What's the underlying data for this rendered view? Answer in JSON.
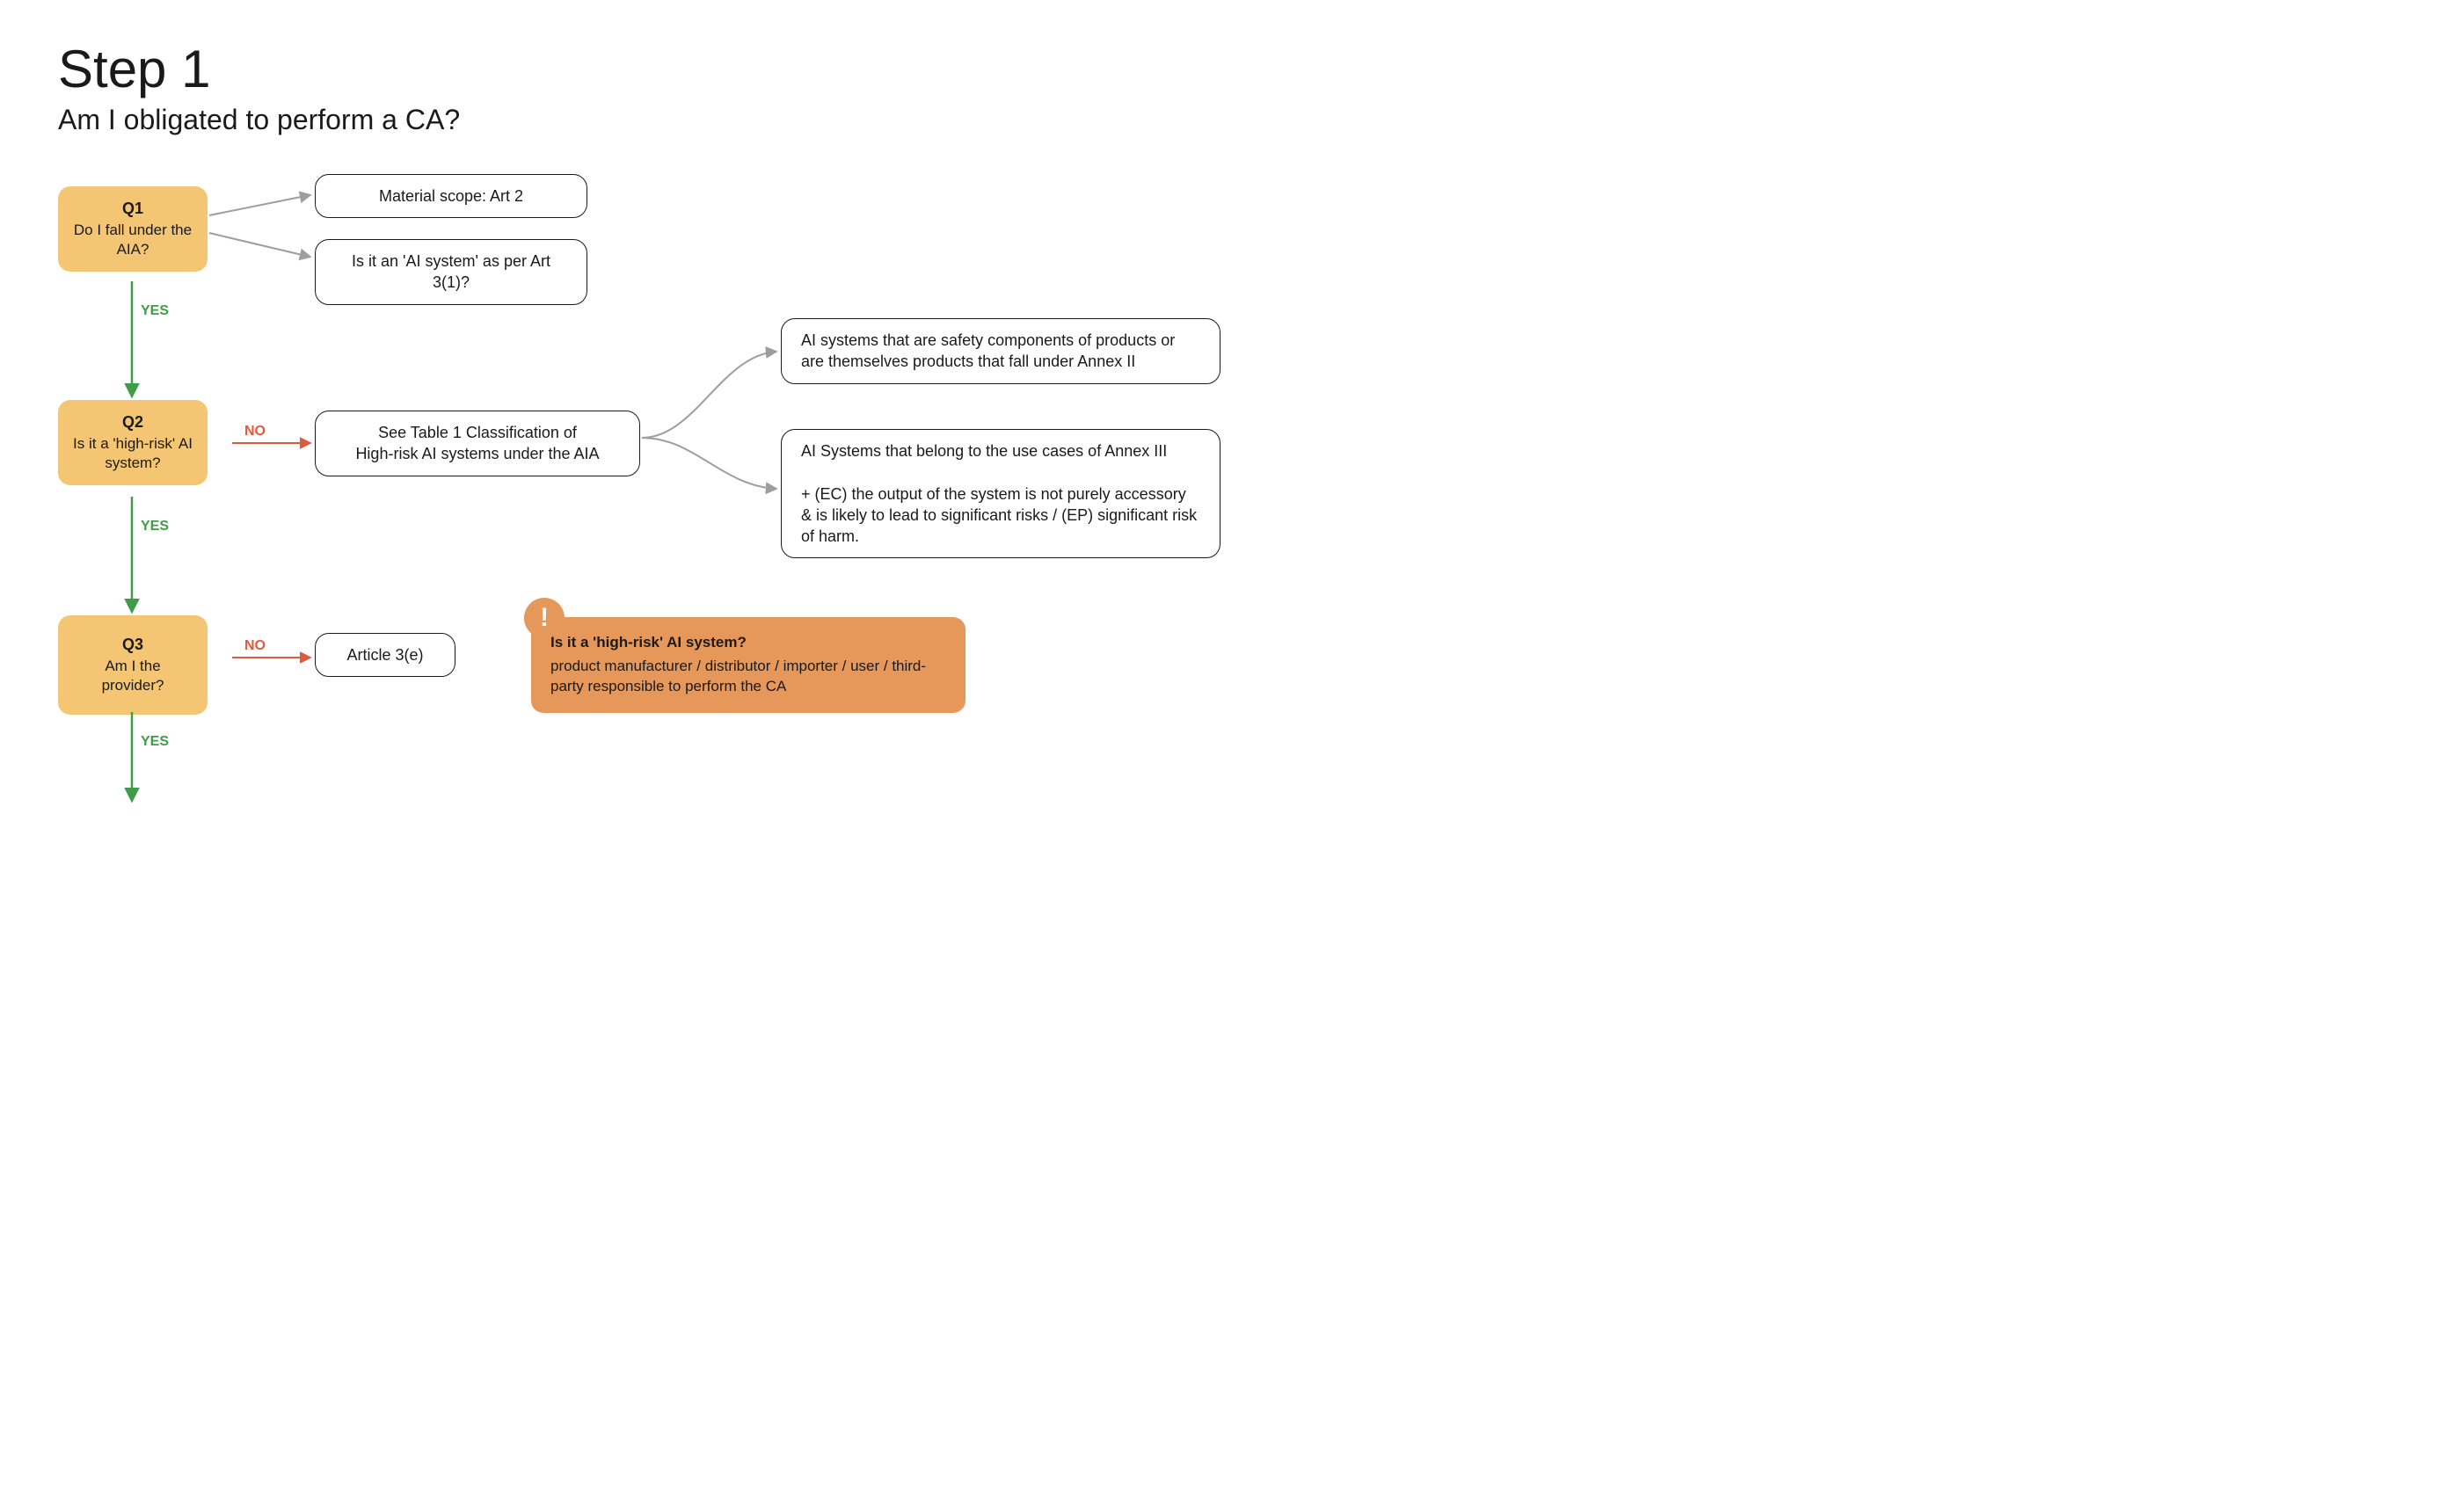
{
  "header": {
    "title": "Step 1",
    "subtitle": "Am I obligated to perform a CA?"
  },
  "q1": {
    "num": "Q1",
    "text": "Do I fall under the AIA?",
    "yes": "YES"
  },
  "q2": {
    "num": "Q2",
    "text": "Is it a 'high-risk' AI system?",
    "yes": "YES",
    "no": "NO"
  },
  "q3": {
    "num": "Q3",
    "text": "Am I the provider?",
    "yes": "YES",
    "no": "NO"
  },
  "boxes": {
    "material_scope": "Material scope: Art 2",
    "ai_system_def": "Is it an 'AI system' as per Art 3(1)?",
    "see_table1_l1": "See Table 1 Classification of",
    "see_table1_l2": "High-risk AI systems under the AIA",
    "annex2": "AI systems that are safety components of products or are themselves products that fall under Annex II",
    "annex3_l1": "AI Systems that belong to the use cases of Annex III",
    "annex3_l2": "+ (EC) the output of the system is not purely accessory & is likely to lead to significant risks / (EP) significant risk of harm.",
    "article3e": "Article 3(e)"
  },
  "callout": {
    "icon": "!",
    "title": "Is it a 'high-risk' AI system?",
    "body": "product manufacturer / distributor / importer / user / third-party responsible to perform the CA"
  },
  "colors": {
    "qbox": "#f4c572",
    "callout": "#e6975a",
    "yes": "#3f9d4a",
    "no": "#d95c3e",
    "grey": "#9e9e9e"
  }
}
